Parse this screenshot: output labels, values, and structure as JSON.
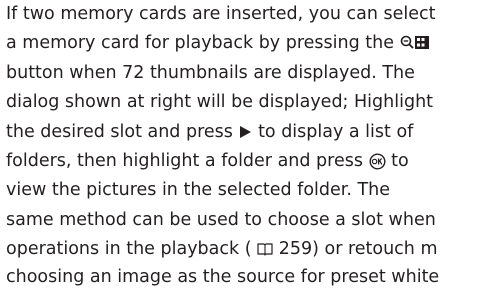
{
  "paragraph": {
    "line1": "If two memory cards are inserted, you can select",
    "line2_before": "a memory card for playback by pressing the",
    "line2_after": "",
    "line3": "button when 72 thumbnails are displayed. The",
    "line4": "dialog shown at right will be displayed; Highlight",
    "line5_before": "the desired slot and press",
    "line5_after": "to display a list of",
    "line6_before": "folders, then highlight a folder and press",
    "line6_after": "to",
    "line7": "view the pictures in the selected folder. The",
    "line8": "same method can be used to choose a slot when",
    "line9_before": "operations in the playback (",
    "line9_page": "259",
    "line9_after": ") or retouch m",
    "line10": "choosing an image as the source for preset white"
  },
  "icons": {
    "zoom_out_thumbnail": "zoom-out-thumbnail-icon",
    "right_arrow": "right-arrow-icon",
    "ok_button": "ok-button-icon",
    "page_reference": "book-reference-icon"
  }
}
